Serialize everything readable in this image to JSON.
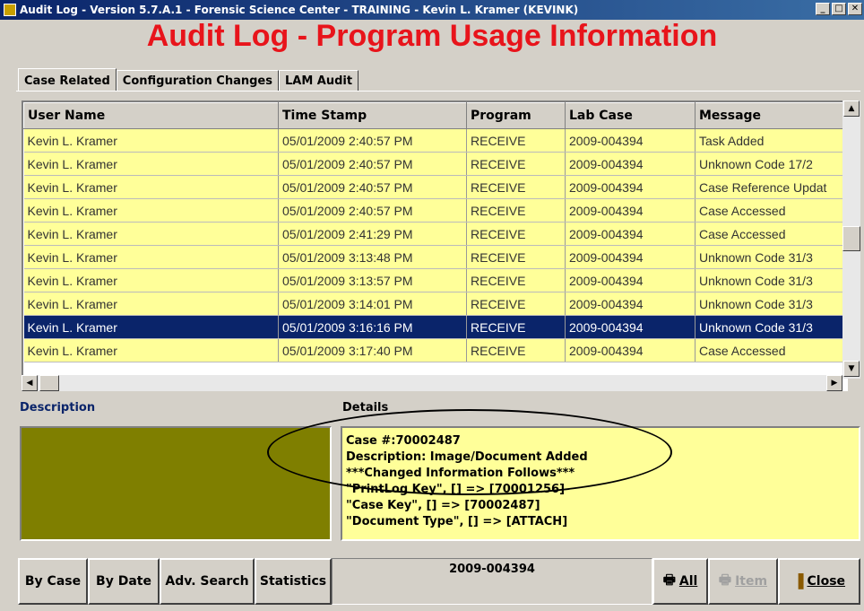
{
  "window": {
    "title": "Audit Log - Version 5.7.A.1 - Forensic Science Center - TRAINING - Kevin L. Kramer (KEVINK)",
    "controls": [
      "_",
      "□",
      "✕"
    ]
  },
  "heading": "Audit Log - Program Usage Information",
  "tabs": [
    {
      "label": "Case Related",
      "active": true
    },
    {
      "label": "Configuration Changes",
      "active": false
    },
    {
      "label": "LAM Audit",
      "active": false
    }
  ],
  "grid": {
    "columns": [
      "User Name",
      "Time Stamp",
      "Program",
      "Lab Case",
      "Message"
    ],
    "rows": [
      [
        "Kevin L. Kramer",
        "05/01/2009 2:40:57 PM",
        "RECEIVE",
        "2009-004394",
        "Task Added"
      ],
      [
        "Kevin L. Kramer",
        "05/01/2009 2:40:57 PM",
        "RECEIVE",
        "2009-004394",
        "Unknown Code 17/2"
      ],
      [
        "Kevin L. Kramer",
        "05/01/2009 2:40:57 PM",
        "RECEIVE",
        "2009-004394",
        "Case Reference Updat"
      ],
      [
        "Kevin L. Kramer",
        "05/01/2009 2:40:57 PM",
        "RECEIVE",
        "2009-004394",
        "Case Accessed"
      ],
      [
        "Kevin L. Kramer",
        "05/01/2009 2:41:29 PM",
        "RECEIVE",
        "2009-004394",
        "Case Accessed"
      ],
      [
        "Kevin L. Kramer",
        "05/01/2009 3:13:48 PM",
        "RECEIVE",
        "2009-004394",
        "Unknown Code 31/3"
      ],
      [
        "Kevin L. Kramer",
        "05/01/2009 3:13:57 PM",
        "RECEIVE",
        "2009-004394",
        "Unknown Code 31/3"
      ],
      [
        "Kevin L. Kramer",
        "05/01/2009 3:14:01 PM",
        "RECEIVE",
        "2009-004394",
        "Unknown Code 31/3"
      ],
      [
        "Kevin L. Kramer",
        "05/01/2009 3:16:16 PM",
        "RECEIVE",
        "2009-004394",
        "Unknown Code 31/3"
      ],
      [
        "Kevin L. Kramer",
        "05/01/2009 3:17:40 PM",
        "RECEIVE",
        "2009-004394",
        "Case Accessed"
      ]
    ],
    "selected_row": 8
  },
  "description": {
    "label": "Description"
  },
  "details": {
    "label": "Details",
    "lines": [
      "Case #:70002487",
      "Description: Image/Document Added",
      "***Changed Information Follows***",
      "\"PrintLog Key\", [] => [70001256]",
      "\"Case Key\", [] => [70002487]",
      "\"Document Type\", [] => [ATTACH]"
    ]
  },
  "buttons": {
    "by_case": "By Case",
    "by_date": "By Date",
    "adv_search": "Adv. Search",
    "statistics": "Statistics",
    "all": "All",
    "item": "Item",
    "close": "Close"
  },
  "current_case": "2009-004394",
  "colors": {
    "heading": "#e8141b",
    "row_bg": "#ffff99",
    "selected_bg": "#0a246a",
    "description_bg": "#7f7f00"
  }
}
